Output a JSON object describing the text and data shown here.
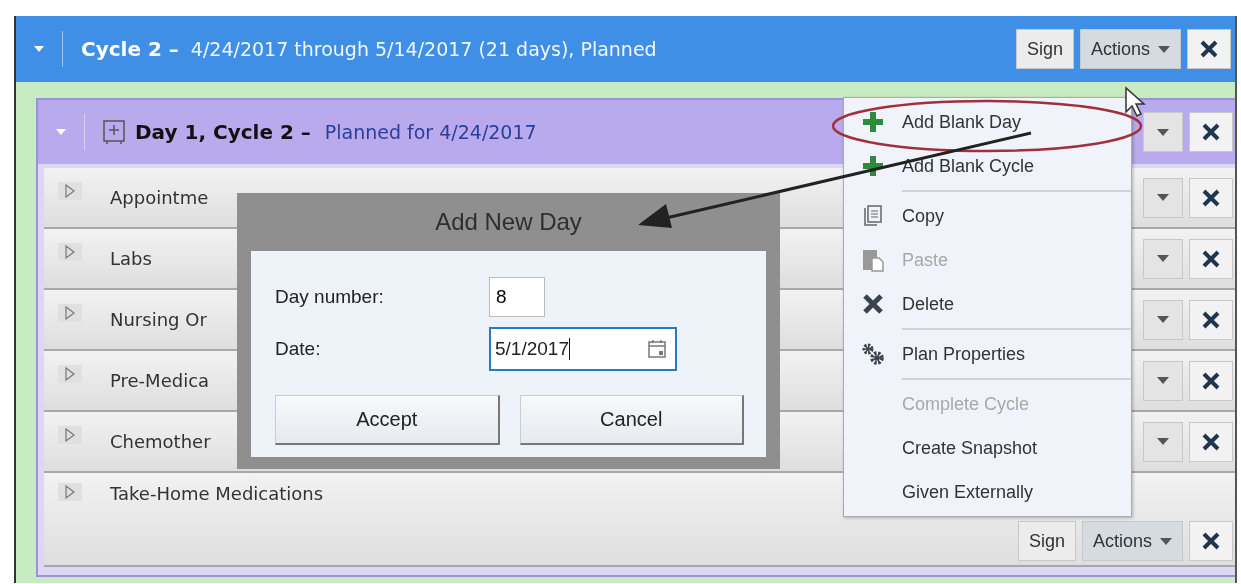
{
  "cycle": {
    "name": "Cycle 2 –",
    "detail": "4/24/2017 through 5/14/2017 (21 days), Planned",
    "sign": "Sign",
    "actions": "Actions"
  },
  "day": {
    "name": "Day 1, Cycle 2 –",
    "detail": "Planned for 4/24/2017"
  },
  "rows": [
    {
      "label": "Appointme"
    },
    {
      "label": "Labs"
    },
    {
      "label": "Nursing Or"
    },
    {
      "label": "Pre-Medica"
    },
    {
      "label": "Chemother"
    },
    {
      "label": "Take-Home Medications",
      "sign": "Sign",
      "actions": "Actions"
    }
  ],
  "dialog": {
    "title": "Add New Day",
    "fields": [
      {
        "label": "Day number:",
        "value": "8",
        "kind": "number"
      },
      {
        "label": "Date:",
        "value": "5/1/2017",
        "kind": "date"
      }
    ],
    "buttons": [
      "Accept",
      "Cancel"
    ]
  },
  "menu": [
    {
      "kind": "add",
      "label": "Add Blank Day",
      "disabled": false
    },
    {
      "kind": "add",
      "label": "Add Blank Cycle",
      "disabled": false
    },
    {
      "kind": "separator"
    },
    {
      "kind": "copy",
      "label": "Copy",
      "disabled": false
    },
    {
      "kind": "paste",
      "label": "Paste",
      "disabled": true
    },
    {
      "kind": "delete",
      "label": "Delete",
      "disabled": false
    },
    {
      "kind": "separator"
    },
    {
      "kind": "settings",
      "label": "Plan Properties",
      "disabled": false
    },
    {
      "kind": "separator"
    },
    {
      "kind": "text",
      "label": "Complete Cycle",
      "disabled": true
    },
    {
      "kind": "text",
      "label": "Create Snapshot",
      "disabled": false
    },
    {
      "kind": "text",
      "label": "Given Externally",
      "disabled": false
    }
  ]
}
